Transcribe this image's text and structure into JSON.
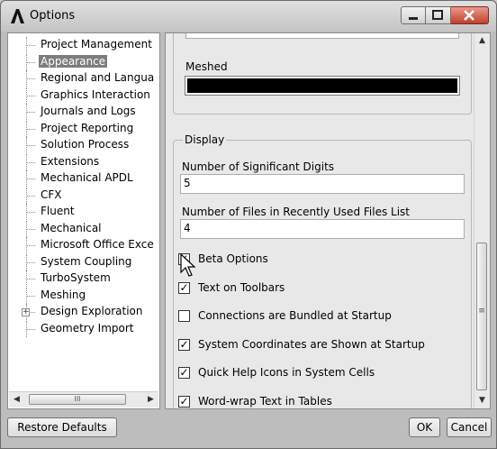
{
  "window": {
    "title": "Options",
    "icon": "ansys-logo-icon"
  },
  "titlebar_buttons": [
    "minimize-icon",
    "maximize-icon",
    "close-icon"
  ],
  "tree": {
    "items": [
      {
        "label": "Project Management",
        "selected": false
      },
      {
        "label": "Appearance",
        "selected": true
      },
      {
        "label": "Regional and Langua",
        "selected": false
      },
      {
        "label": "Graphics Interaction",
        "selected": false
      },
      {
        "label": "Journals and Logs",
        "selected": false
      },
      {
        "label": "Project Reporting",
        "selected": false
      },
      {
        "label": "Solution Process",
        "selected": false
      },
      {
        "label": "Extensions",
        "selected": false
      },
      {
        "label": "Mechanical APDL",
        "selected": false
      },
      {
        "label": "CFX",
        "selected": false
      },
      {
        "label": "Fluent",
        "selected": false
      },
      {
        "label": "Mechanical",
        "selected": false
      },
      {
        "label": "Microsoft Office Exce",
        "selected": false
      },
      {
        "label": "System Coupling",
        "selected": false
      },
      {
        "label": "TurboSystem",
        "selected": false
      },
      {
        "label": "Meshing",
        "selected": false
      },
      {
        "label": "Design Exploration",
        "selected": false,
        "expandable": true
      },
      {
        "label": "Geometry Import",
        "selected": false
      }
    ]
  },
  "appearance": {
    "meshed_label": "Meshed",
    "meshed_color": "#000000"
  },
  "display": {
    "group_title": "Display",
    "sig_digits_label": "Number of Significant Digits",
    "sig_digits_value": "5",
    "recent_files_label": "Number of Files in Recently Used Files List",
    "recent_files_value": "4",
    "checkboxes": [
      {
        "label": "Beta Options",
        "checked": true
      },
      {
        "label": "Text on Toolbars",
        "checked": true
      },
      {
        "label": "Connections are Bundled at Startup",
        "checked": false
      },
      {
        "label": "System Coordinates are Shown at Startup",
        "checked": true
      },
      {
        "label": "Quick Help Icons in System Cells",
        "checked": true
      },
      {
        "label": "Word-wrap Text in Tables",
        "checked": true
      }
    ]
  },
  "footer": {
    "restore_label": "Restore Defaults",
    "ok_label": "OK",
    "cancel_label": "Cancel"
  }
}
